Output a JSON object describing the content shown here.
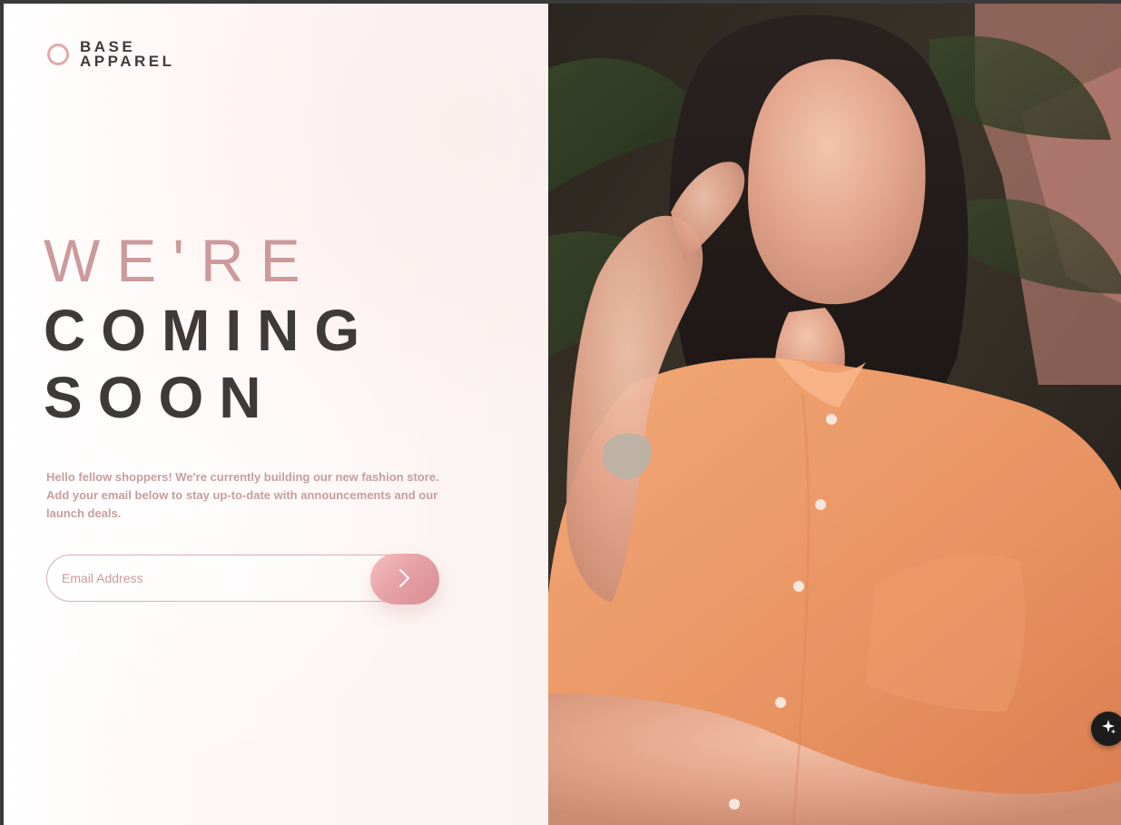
{
  "brand": {
    "line1": "BASE",
    "line2": "APPAREL"
  },
  "hero": {
    "line1": "WE'RE",
    "line2": "COMING",
    "line3": "SOON"
  },
  "description": "Hello fellow shoppers! We're currently building our new fashion store. Add your email below to stay up-to-date with announcements and our launch deals.",
  "signup": {
    "placeholder": "Email Address",
    "value": ""
  },
  "colors": {
    "accent_pink": "#cc9a9c",
    "heading_dark": "#3f3a3a",
    "button_gradient_start": "#f8bfbf",
    "button_gradient_end": "#d88c93"
  },
  "icons": {
    "logo": "ring-logo-icon",
    "submit": "chevron-right-icon",
    "floating": "sparkles-icon"
  }
}
